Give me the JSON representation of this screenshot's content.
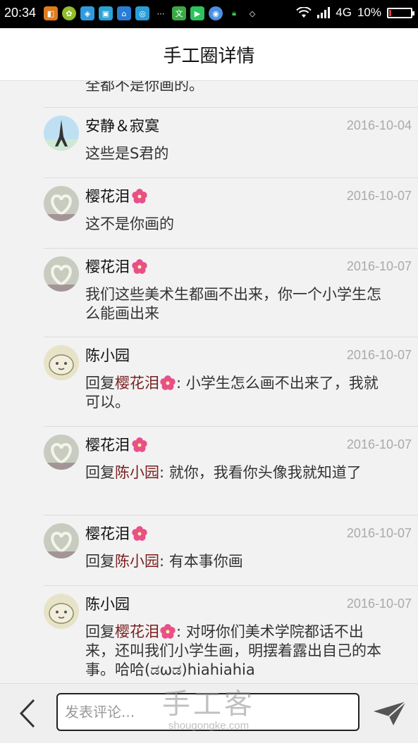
{
  "status": {
    "time": "20:34",
    "network": "4G",
    "battery": "10%",
    "battery_level": 0.1
  },
  "header": {
    "title": "手工圈详情"
  },
  "feed": {
    "cut_text": "全都不是你画的。",
    "comments": [
      {
        "name": "安静＆寂寞",
        "date": "2016-10-04",
        "text": "这些是S君的",
        "avatar": "eiffel-tower"
      },
      {
        "name": "樱花泪",
        "date": "2016-10-07",
        "text": "这不是你画的",
        "avatar": "heart"
      },
      {
        "name": "樱花泪",
        "date": "2016-10-07",
        "text": "我们这些美术生都画不出来，你一个小学生怎么能画出来",
        "avatar": "heart"
      },
      {
        "name": "陈小园",
        "date": "2016-10-07",
        "reply_prefix": "回复",
        "reply_to": "樱花泪",
        "text": ": 小学生怎么画不出来了，我就可以。",
        "avatar": "cartoon"
      },
      {
        "name": "樱花泪",
        "date": "2016-10-07",
        "reply_prefix": "回复",
        "reply_to": "陈小园",
        "text": ": 就你，我看你头像我就知道了",
        "avatar": "heart"
      },
      {
        "name": "樱花泪",
        "date": "2016-10-07",
        "reply_prefix": "回复",
        "reply_to": "陈小园",
        "text": ": 有本事你画",
        "avatar": "heart"
      },
      {
        "name": "陈小园",
        "date": "2016-10-07",
        "reply_prefix": "回复",
        "reply_to": "樱花泪",
        "text": ": 对呀你们美术学院都话不出来，还叫我们小学生画，明摆着露出自己的本事。哈哈(ಡωಡ)hiahiahia",
        "avatar": "cartoon"
      }
    ]
  },
  "bottom": {
    "placeholder": "发表评论...",
    "watermark": "手工客",
    "watermark_url": "shougongke.com"
  },
  "colors": {
    "reply_name": "#7a1f1f",
    "flower": "#e8508a"
  }
}
